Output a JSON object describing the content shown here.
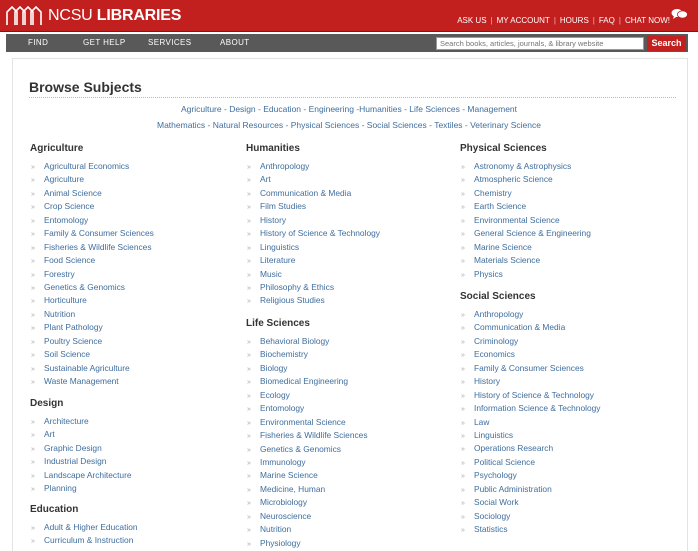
{
  "header": {
    "logo_text_main": "NCSU",
    "logo_text_bold": "LIBRARIES",
    "util_links": [
      "ASK US",
      "MY ACCOUNT",
      "HOURS",
      "FAQ",
      "CHAT NOW!"
    ],
    "util_separator": "|",
    "chat_icon": "chat-bubbles-icon"
  },
  "nav": {
    "items": [
      "FIND",
      "GET HELP",
      "SERVICES",
      "ABOUT"
    ],
    "search_placeholder": "Search books, articles, journals, & library website",
    "search_button": "Search"
  },
  "main": {
    "title": "Browse Subjects",
    "quick_links_row1": [
      "Agriculture",
      "Design",
      "Education",
      "Engineering",
      "Humanities",
      "Life Sciences",
      "Management"
    ],
    "quick_links_row2": [
      "Mathematics",
      "Natural Resources",
      "Physical Sciences",
      "Social Sciences",
      "Textiles",
      "Veterinary Science"
    ],
    "columns": [
      [
        {
          "title": "Agriculture",
          "items": [
            "Agricultural Economics",
            "Agriculture",
            "Animal Science",
            "Crop Science",
            "Entomology",
            "Family & Consumer Sciences",
            "Fisheries & Wildlife Sciences",
            "Food Science",
            "Forestry",
            "Genetics & Genomics",
            "Horticulture",
            "Nutrition",
            "Plant Pathology",
            "Poultry Science",
            "Soil Science",
            "Sustainable Agriculture",
            "Waste Management"
          ]
        },
        {
          "title": "Design",
          "items": [
            "Architecture",
            "Art",
            "Graphic Design",
            "Industrial Design",
            "Landscape Architecture",
            "Planning"
          ]
        },
        {
          "title": "Education",
          "items": [
            "Adult & Higher Education",
            "Curriculum & Instruction"
          ]
        }
      ],
      [
        {
          "title": "Humanities",
          "items": [
            "Anthropology",
            "Art",
            "Communication & Media",
            "Film Studies",
            "History",
            "History of Science & Technology",
            "Linguistics",
            "Literature",
            "Music",
            "Philosophy & Ethics",
            "Religious Studies"
          ]
        },
        {
          "title": "Life Sciences",
          "items": [
            "Behavioral Biology",
            "Biochemistry",
            "Biology",
            "Biomedical Engineering",
            "Ecology",
            "Entomology",
            "Environmental Science",
            "Fisheries & Wildlife Sciences",
            "Genetics & Genomics",
            "Immunology",
            "Marine Science",
            "Medicine, Human",
            "Microbiology",
            "Neuroscience",
            "Nutrition",
            "Physiology"
          ]
        }
      ],
      [
        {
          "title": "Physical Sciences",
          "items": [
            "Astronomy & Astrophysics",
            "Atmospheric Science",
            "Chemistry",
            "Earth Science",
            "Environmental Science",
            "General Science & Engineering",
            "Marine Science",
            "Materials Science",
            "Physics"
          ]
        },
        {
          "title": "Social Sciences",
          "items": [
            "Anthropology",
            "Communication & Media",
            "Criminology",
            "Economics",
            "Family & Consumer Sciences",
            "History",
            "History of Science & Technology",
            "Information Science & Technology",
            "Law",
            "Linguistics",
            "Operations Research",
            "Political Science",
            "Psychology",
            "Public Administration",
            "Social Work",
            "Sociology",
            "Statistics"
          ]
        }
      ]
    ]
  },
  "colors": {
    "brand_red": "#c21f1f",
    "nav_gray": "#595959",
    "link_blue": "#3f6e9e"
  }
}
